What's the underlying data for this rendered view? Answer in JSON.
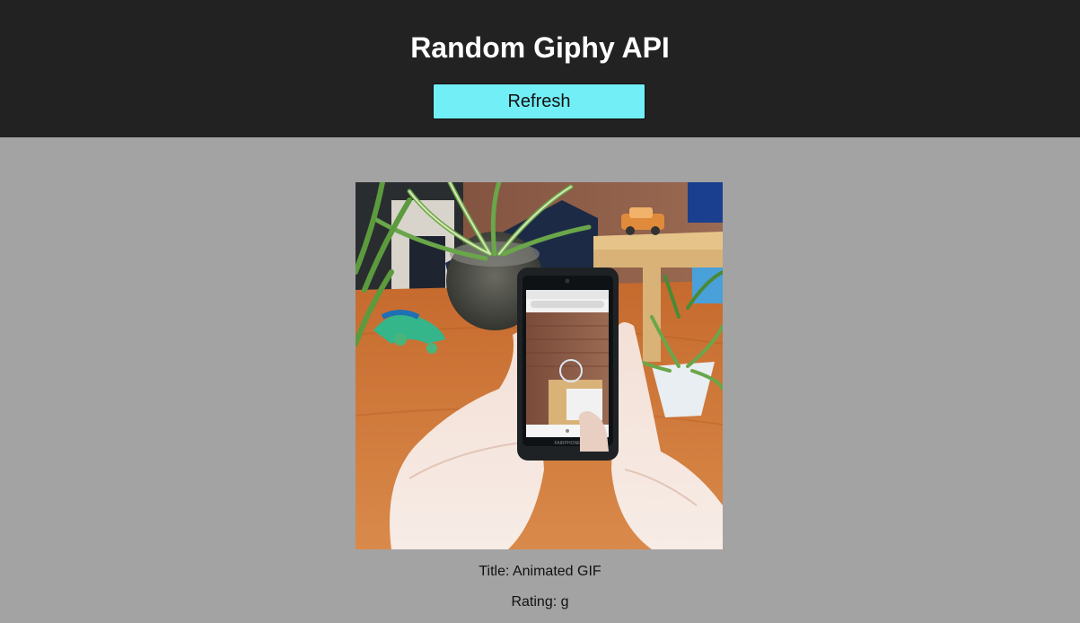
{
  "header": {
    "title": "Random Giphy API",
    "refresh_label": "Refresh",
    "background_color": "#222222",
    "button_color": "#72eef6"
  },
  "gif": {
    "title_label": "Title: Animated GIF",
    "rating_label": "Rating: g",
    "phone_brand": "FAIRPHONE"
  },
  "page": {
    "background_color": "#a3a3a3"
  }
}
